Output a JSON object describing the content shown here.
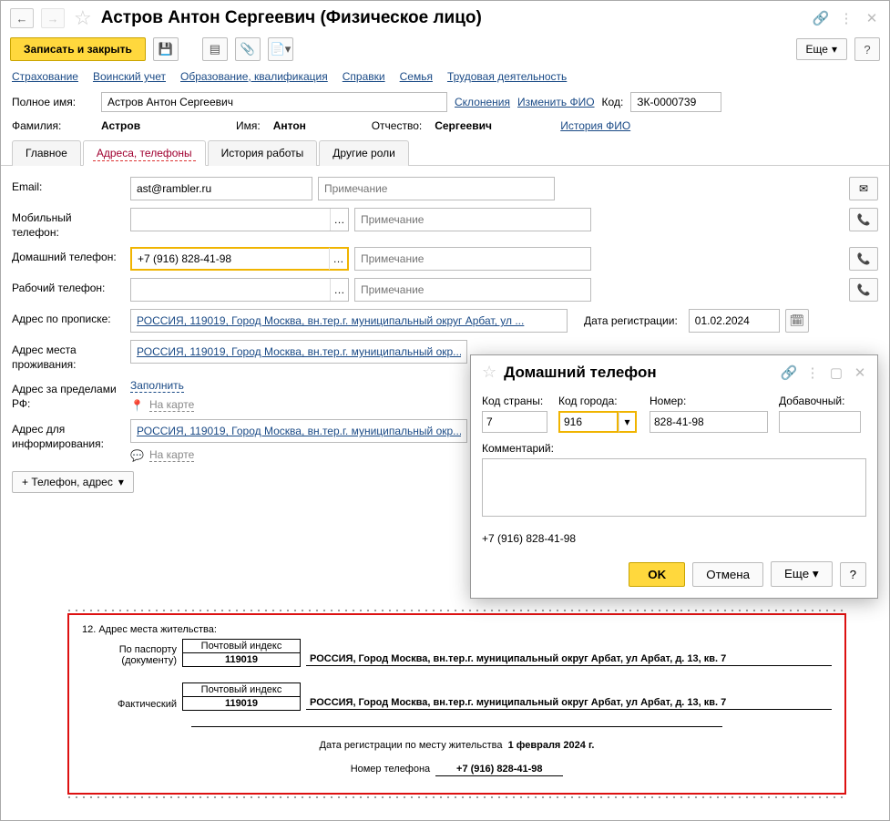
{
  "header": {
    "title": "Астров Антон Сергеевич (Физическое лицо)",
    "save_close": "Записать и закрыть",
    "more": "Еще"
  },
  "links": [
    "Страхование",
    "Воинский учет",
    "Образование, квалификация",
    "Справки",
    "Семья",
    "Трудовая деятельность"
  ],
  "fullname": {
    "label": "Полное имя:",
    "value": "Астров Антон Сергеевич",
    "decl": "Склонения",
    "change": "Изменить ФИО",
    "code_label": "Код:",
    "code": "ЗК-0000739"
  },
  "namerow": {
    "f_label": "Фамилия:",
    "f": "Астров",
    "i_label": "Имя:",
    "i": "Антон",
    "o_label": "Отчество:",
    "o": "Сергеевич",
    "history": "История ФИО"
  },
  "tabs": [
    "Главное",
    "Адреса, телефоны",
    "История работы",
    "Другие роли"
  ],
  "fields": {
    "email_label": "Email:",
    "email_value": "ast@rambler.ru",
    "note_ph": "Примечание",
    "mobile_label": "Мобильный телефон:",
    "home_label": "Домашний телефон:",
    "home_value": "+7 (916) 828-41-98",
    "work_label": "Рабочий телефон:",
    "addr_reg_label": "Адрес по прописке:",
    "addr_reg_value": "РОССИЯ, 119019, Город Москва, вн.тер.г. муниципальный округ Арбат, ул ...",
    "reg_date_label": "Дата регистрации:",
    "reg_date": "01.02.2024",
    "addr_live_label": "Адрес места проживания:",
    "addr_live_value": "РОССИЯ, 119019, Город Москва, вн.тер.г. муниципальный окр...",
    "addr_abroad_label": "Адрес за пределами РФ:",
    "fill": "Заполнить",
    "on_map": "На карте",
    "addr_inform_label": "Адрес для информирования:",
    "addr_inform_value": "РОССИЯ, 119019, Город Москва, вн.тер.г. муниципальный окр...",
    "add_btn": "+ Телефон, адрес"
  },
  "popup": {
    "title": "Домашний телефон",
    "country_label": "Код страны:",
    "country": "7",
    "city_label": "Код города:",
    "city": "916",
    "number_label": "Номер:",
    "number": "828-41-98",
    "ext_label": "Добавочный:",
    "ext": "",
    "comment_label": "Комментарий:",
    "preview": "+7 (916) 828-41-98",
    "ok": "OK",
    "cancel": "Отмена",
    "more": "Еще"
  },
  "doc": {
    "section": "12. Адрес места жительства:",
    "post_index_label": "Почтовый индекс",
    "index": "119019",
    "passport": "По паспорту (документу)",
    "actual": "Фактический",
    "addr": "РОССИЯ,  Город Москва, вн.тер.г. муниципальный округ Арбат, ул Арбат, д. 13, кв. 7",
    "reg_line_lbl": "Дата регистрации по месту жительства",
    "reg_line_val": "1 февраля 2024 г.",
    "phone_lbl": "Номер телефона",
    "phone_val": "+7 (916) 828-41-98"
  }
}
